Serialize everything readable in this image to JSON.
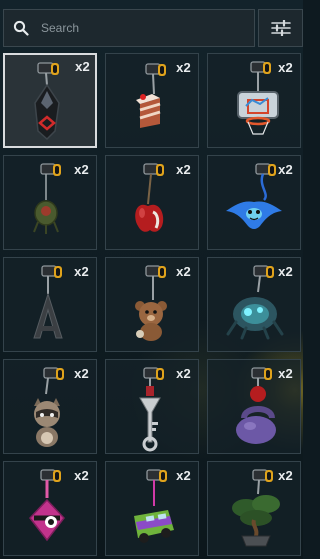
{
  "search": {
    "placeholder": "Search"
  },
  "icons": {
    "search": "search-icon",
    "filter": "sliders-icon"
  },
  "colors": {
    "keyring_gold": "#e0a31c",
    "selected_border": "#d9dcde",
    "panel_border": "#34434b"
  },
  "items": [
    {
      "name": "dark-crystal-charm",
      "qty": "x2",
      "selected": true
    },
    {
      "name": "cake-slice-charm",
      "qty": "x2"
    },
    {
      "name": "basketball-hoop-charm",
      "qty": "x2"
    },
    {
      "name": "olive-robot-charm",
      "qty": "x2"
    },
    {
      "name": "red-apple-charm",
      "qty": "x2"
    },
    {
      "name": "blue-manta-ray-charm",
      "qty": "x2"
    },
    {
      "name": "metal-a-frame-charm",
      "qty": "x2"
    },
    {
      "name": "brown-bear-charm",
      "qty": "x2"
    },
    {
      "name": "teal-spider-creature-charm",
      "qty": "x2"
    },
    {
      "name": "raccoon-charm",
      "qty": "x2"
    },
    {
      "name": "silver-key-charm",
      "qty": "x2"
    },
    {
      "name": "kettlebell-charm",
      "qty": "x2"
    },
    {
      "name": "pink-gem-charm",
      "qty": "x2"
    },
    {
      "name": "green-van-charm",
      "qty": "x2"
    },
    {
      "name": "bonsai-tree-charm",
      "qty": "x2"
    }
  ]
}
